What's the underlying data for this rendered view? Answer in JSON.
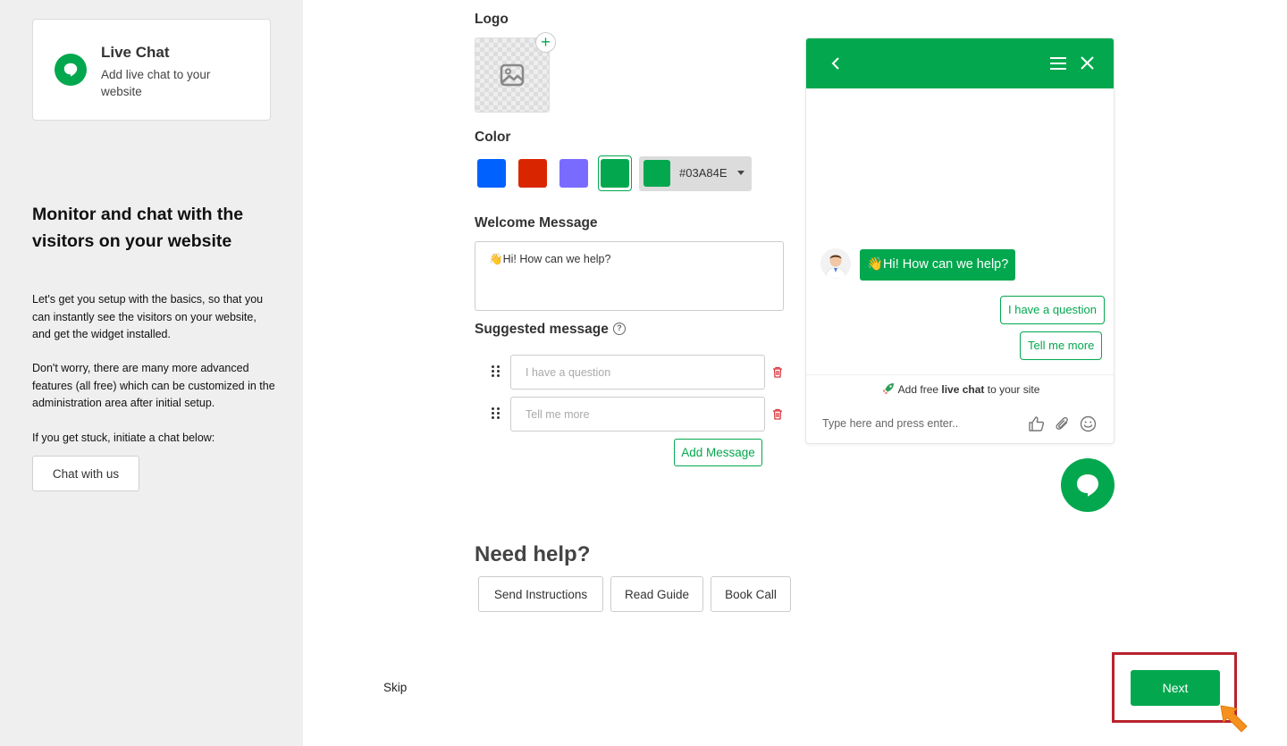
{
  "sidebar": {
    "product": {
      "title": "Live Chat",
      "description": "Add live chat to your website",
      "icon": "chat-bubble-icon"
    },
    "heading": "Monitor and chat with the visitors on your website",
    "paragraphs": [
      "Let's get you setup with the basics, so that you can instantly see the visitors on your website, and get the widget installed.",
      "Don't worry, there are many more advanced features (all free) which can be customized in the administration area after initial setup.",
      "If you get stuck, initiate a chat below:"
    ],
    "chat_button": "Chat with us"
  },
  "form": {
    "logo_label": "Logo",
    "color_label": "Color",
    "colors": [
      "#0061FF",
      "#D92600",
      "#7A6BFF",
      "#03A84E"
    ],
    "selected_color": "#03A84E",
    "hex_value": "#03A84E",
    "welcome_label": "Welcome Message",
    "welcome_message": "👋Hi! How can we help?",
    "suggested_label": "Suggested message",
    "help_glyph": "?",
    "suggested_messages": [
      {
        "placeholder": "I have a question"
      },
      {
        "placeholder": "Tell me more"
      }
    ],
    "add_message": "Add Message"
  },
  "preview": {
    "header_color": "#03A84E",
    "greeting": "👋Hi! How can we help?",
    "quick_replies": [
      "I have a question",
      "Tell me more"
    ],
    "powered_prefix": "Add free ",
    "powered_bold": "live chat",
    "powered_suffix": " to your site",
    "input_placeholder": "Type here and press enter.."
  },
  "help": {
    "title": "Need help?",
    "buttons": [
      "Send Instructions",
      "Read Guide",
      "Book Call"
    ]
  },
  "footer": {
    "skip": "Skip",
    "next": "Next",
    "highlight_color": "#B8232E",
    "cursor_color": "#F5921E"
  }
}
